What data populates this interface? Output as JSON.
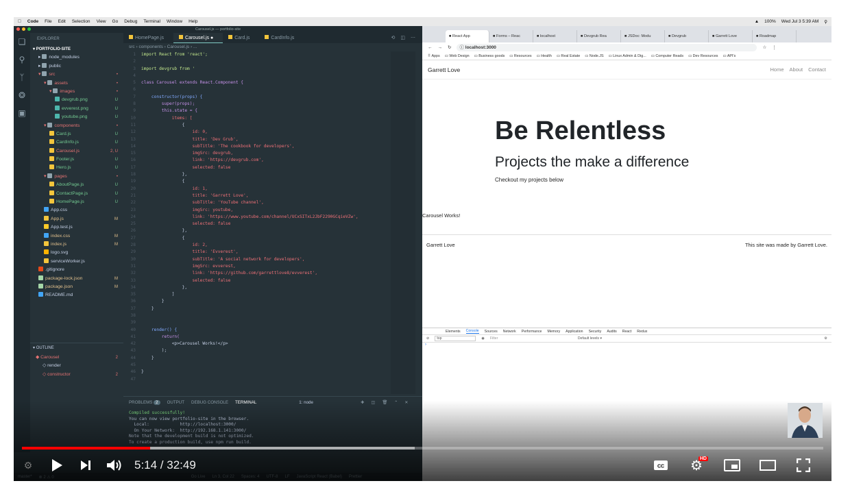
{
  "menubar": {
    "items": [
      "Code",
      "File",
      "Edit",
      "Selection",
      "View",
      "Go",
      "Debug",
      "Terminal",
      "Window",
      "Help"
    ],
    "right": [
      "100%",
      "Wed Jul 3  5:39 AM"
    ]
  },
  "vscode": {
    "window_title": "Carousel.js — portfolio-site",
    "explorer_label": "EXPLORER",
    "project": "PORTFOLIO-SITE",
    "tree": [
      {
        "label": "node_modules",
        "depth": 1,
        "kind": "folder",
        "status": ""
      },
      {
        "label": "public",
        "depth": 1,
        "kind": "folder",
        "status": ""
      },
      {
        "label": "src",
        "depth": 1,
        "kind": "folder-open",
        "status": "•"
      },
      {
        "label": "assets",
        "depth": 2,
        "kind": "folder-open",
        "status": "•"
      },
      {
        "label": "images",
        "depth": 3,
        "kind": "folder-open",
        "status": "•"
      },
      {
        "label": "devgrub.png",
        "depth": 4,
        "kind": "image",
        "status": "U"
      },
      {
        "label": "evverest.png",
        "depth": 4,
        "kind": "image",
        "status": "U"
      },
      {
        "label": "youtube.png",
        "depth": 4,
        "kind": "image",
        "status": "U"
      },
      {
        "label": "components",
        "depth": 2,
        "kind": "folder-open",
        "status": "•"
      },
      {
        "label": "Card.js",
        "depth": 3,
        "kind": "js",
        "status": "U"
      },
      {
        "label": "CardInfo.js",
        "depth": 3,
        "kind": "js",
        "status": "U"
      },
      {
        "label": "Carousel.js",
        "depth": 3,
        "kind": "js",
        "status": "2, U"
      },
      {
        "label": "Footer.js",
        "depth": 3,
        "kind": "js",
        "status": "U"
      },
      {
        "label": "Hero.js",
        "depth": 3,
        "kind": "js",
        "status": "U"
      },
      {
        "label": "pages",
        "depth": 2,
        "kind": "folder-open",
        "status": "•"
      },
      {
        "label": "AboutPage.js",
        "depth": 3,
        "kind": "js",
        "status": "U"
      },
      {
        "label": "ContactPage.js",
        "depth": 3,
        "kind": "js",
        "status": "U"
      },
      {
        "label": "HomePage.js",
        "depth": 3,
        "kind": "js",
        "status": "U"
      },
      {
        "label": "App.css",
        "depth": 2,
        "kind": "css",
        "status": ""
      },
      {
        "label": "App.js",
        "depth": 2,
        "kind": "js",
        "status": "M"
      },
      {
        "label": "App.test.js",
        "depth": 2,
        "kind": "test",
        "status": ""
      },
      {
        "label": "index.css",
        "depth": 2,
        "kind": "css",
        "status": "M"
      },
      {
        "label": "index.js",
        "depth": 2,
        "kind": "js",
        "status": "M"
      },
      {
        "label": "logo.svg",
        "depth": 2,
        "kind": "svg",
        "status": ""
      },
      {
        "label": "serviceWorker.js",
        "depth": 2,
        "kind": "js",
        "status": ""
      },
      {
        "label": ".gitignore",
        "depth": 1,
        "kind": "git",
        "status": ""
      },
      {
        "label": "package-lock.json",
        "depth": 1,
        "kind": "json",
        "status": "M"
      },
      {
        "label": "package.json",
        "depth": 1,
        "kind": "json",
        "status": "M"
      },
      {
        "label": "README.md",
        "depth": 1,
        "kind": "md",
        "status": ""
      }
    ],
    "outline_label": "OUTLINE",
    "outline": [
      {
        "label": "Carousel",
        "status": "2"
      },
      {
        "label": "render",
        "status": ""
      },
      {
        "label": "constructor",
        "status": "2"
      }
    ],
    "tabs": [
      "HomePage.js",
      "Carousel.js",
      "Card.js",
      "CardInfo.js"
    ],
    "active_tab": 1,
    "breadcrumb": "src › components › Carousel.js › ...",
    "code_lines": [
      "import React from 'react';",
      "",
      "import devgrub from '",
      "",
      "class Carousel extends React.Component {",
      "",
      "    constructor(props) {",
      "        super(props);",
      "        this.state = {",
      "            items: [",
      "                {",
      "                    id: 0,",
      "                    title: 'Dev Grub',",
      "                    subTitle: 'The cookbook for developers',",
      "                    imgSrc: devgrub,",
      "                    link: 'https://devgrub.com',",
      "                    selected: false",
      "                },",
      "                {",
      "                    id: 1,",
      "                    title: 'Garrett Love',",
      "                    subTitle: 'YouTube channel',",
      "                    imgSrc: youtube,",
      "                    link: 'https://www.youtube.com/channel/UCxSITxL2JbF2290GCqieVZw',",
      "                    selected: false",
      "                },",
      "                {",
      "                    id: 2,",
      "                    title: 'Evverest',",
      "                    subTitle: 'A social network for developers',",
      "                    imgSrc: evverest,",
      "                    link: 'https://github.com/garrettlove8/evverest',",
      "                    selected: false",
      "                },",
      "            ]",
      "        }",
      "    }",
      "",
      "",
      "    render() {",
      "        return(",
      "            <p>Carousel Works!</p>",
      "        );",
      "    }",
      "",
      "}",
      ""
    ],
    "terminal_tabs": [
      "PROBLEMS",
      "OUTPUT",
      "DEBUG CONSOLE",
      "TERMINAL"
    ],
    "problems_count": "2",
    "terminal_select": "1: node",
    "terminal_lines": [
      "Compiled successfully!",
      "",
      "You can now view portfolio-site in the browser.",
      "",
      "  Local:            http://localhost:3000/",
      "  On Your Network:  http://192.168.1.141:3000/",
      "",
      "Note that the development build is not optimized.",
      "To create a production build, use npm run build."
    ],
    "status_items": [
      "master*",
      "⊗ 2 ⚠ 0",
      "Go Live",
      "Ln 3, Col 22",
      "Spaces: 4",
      "UTF-8",
      "LF",
      "JavaScript React (Babel)",
      "Prettier"
    ]
  },
  "chrome": {
    "tabs": [
      "React App",
      "Forms – Reac",
      "localhost",
      "Devgrub Rea",
      "JSDoc: Modu",
      "Devgrub",
      "Garrett Love",
      "Roadmap"
    ],
    "active_tab": 0,
    "url": "localhost:3000",
    "bookmarks": [
      "Apps",
      "Web Design",
      "Business goods",
      "Resources",
      "Health",
      "Real Estate",
      "Node.JS",
      "Linux Admin & Dig...",
      "Computer Reads",
      "Dev Resources",
      "API's"
    ],
    "site": {
      "brand": "Garrett Love",
      "nav": [
        "Home",
        "About",
        "Contact"
      ],
      "hero_title": "Be Relentless",
      "hero_subtitle": "Projects the make a difference",
      "hero_text": "Checkout my projects below",
      "carousel_text": "Carousel Works!",
      "footer_left": "Garrett Love",
      "footer_right": "This site was made by Garrett Love."
    },
    "devtools_tabs": [
      "Elements",
      "Console",
      "Sources",
      "Network",
      "Performance",
      "Memory",
      "Application",
      "Security",
      "Audits",
      "React",
      "Redux"
    ],
    "devtools_active": 1,
    "context": "top",
    "filter_placeholder": "Filter",
    "levels": "Default levels ▾"
  },
  "player": {
    "time": "5:14 / 32:49",
    "progress": 0.16,
    "buffered": 0.49,
    "hd_badge": "HD"
  }
}
